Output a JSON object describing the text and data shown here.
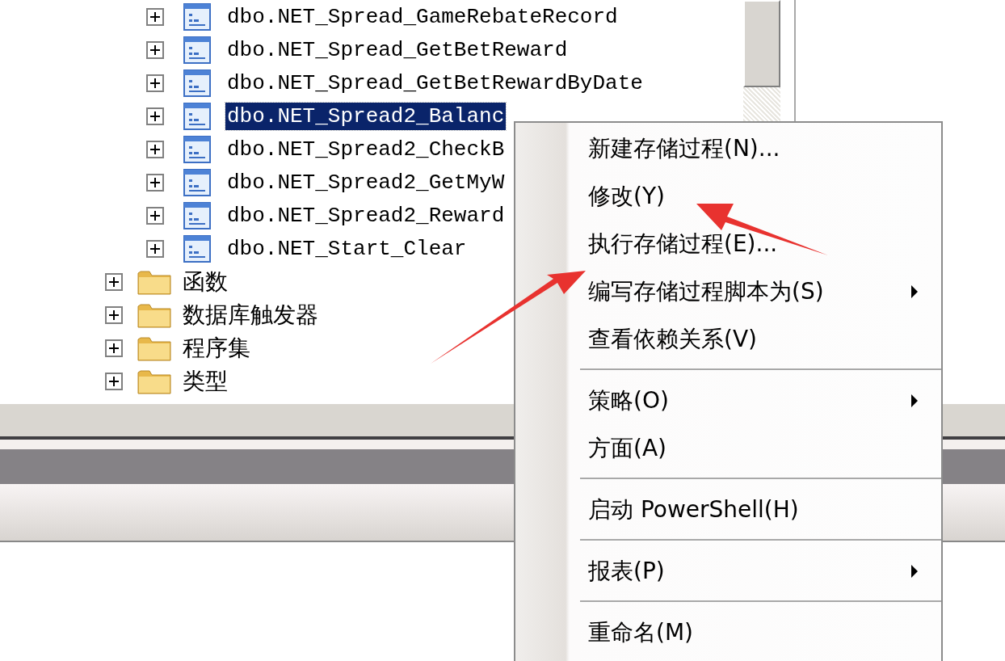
{
  "tree": {
    "items": [
      {
        "label": "dbo.NET_Spread_GameRebateRecord",
        "kind": "procedure",
        "expanded": false,
        "selected": false
      },
      {
        "label": "dbo.NET_Spread_GetBetReward",
        "kind": "procedure",
        "expanded": false,
        "selected": false
      },
      {
        "label": "dbo.NET_Spread_GetBetRewardByDate",
        "kind": "procedure",
        "expanded": false,
        "selected": false
      },
      {
        "label": "dbo.NET_Spread2_Balanc",
        "kind": "procedure",
        "expanded": false,
        "selected": true
      },
      {
        "label": "dbo.NET_Spread2_CheckB",
        "kind": "procedure",
        "expanded": false,
        "selected": false
      },
      {
        "label": "dbo.NET_Spread2_GetMyW",
        "kind": "procedure",
        "expanded": false,
        "selected": false
      },
      {
        "label": "dbo.NET_Spread2_Reward",
        "kind": "procedure",
        "expanded": false,
        "selected": false
      },
      {
        "label": "dbo.NET_Start_Clear",
        "kind": "procedure",
        "expanded": false,
        "selected": false
      },
      {
        "label": "函数",
        "kind": "folder",
        "expanded": false,
        "selected": false
      },
      {
        "label": "数据库触发器",
        "kind": "folder",
        "expanded": false,
        "selected": false
      },
      {
        "label": "程序集",
        "kind": "folder",
        "expanded": false,
        "selected": false
      },
      {
        "label": "类型",
        "kind": "folder",
        "expanded": false,
        "selected": false
      }
    ]
  },
  "context_menu": {
    "items": [
      {
        "kind": "item",
        "label": "新建存储过程(N)...",
        "submenu": false
      },
      {
        "kind": "item",
        "label": "修改(Y)",
        "submenu": false
      },
      {
        "kind": "item",
        "label": "执行存储过程(E)...",
        "submenu": false
      },
      {
        "kind": "item",
        "label": "编写存储过程脚本为(S)",
        "submenu": true
      },
      {
        "kind": "item",
        "label": "查看依赖关系(V)",
        "submenu": false
      },
      {
        "kind": "separator"
      },
      {
        "kind": "item",
        "label": "策略(O)",
        "submenu": true
      },
      {
        "kind": "item",
        "label": "方面(A)",
        "submenu": false
      },
      {
        "kind": "separator"
      },
      {
        "kind": "item",
        "label": "启动 PowerShell(H)",
        "submenu": false
      },
      {
        "kind": "separator"
      },
      {
        "kind": "item",
        "label": "报表(P)",
        "submenu": true
      },
      {
        "kind": "separator"
      },
      {
        "kind": "item",
        "label": "重命名(M)",
        "submenu": false
      }
    ]
  }
}
